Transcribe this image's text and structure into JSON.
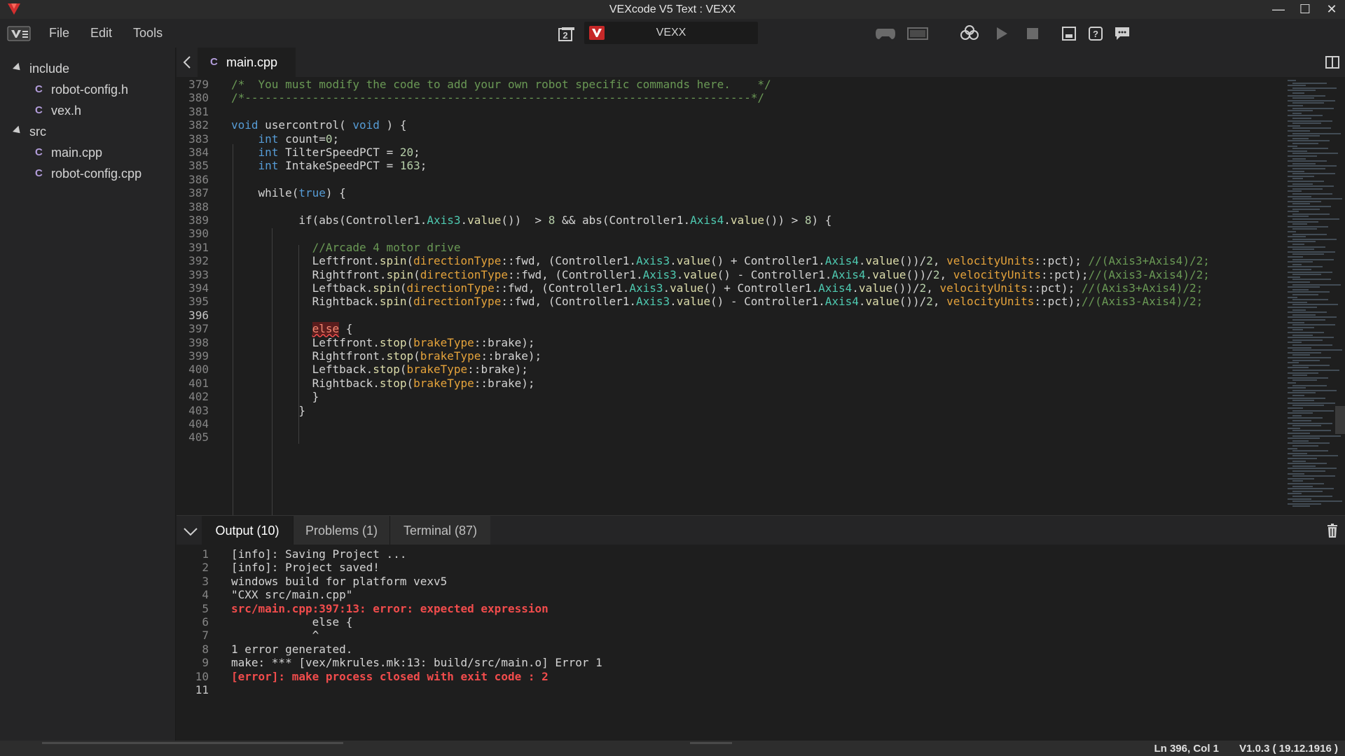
{
  "window": {
    "title": "VEXcode V5 Text : VEXX",
    "minimize": "—",
    "maximize": "☐",
    "close": "✕"
  },
  "menu": {
    "items": [
      "File",
      "Edit",
      "Tools"
    ]
  },
  "device": {
    "name": "VEXX",
    "slot": "2"
  },
  "toolbar": {
    "icons": [
      "controller-icon",
      "brain-screen-icon",
      "download-icon",
      "run-icon",
      "stop-icon",
      "device-info-icon",
      "help-icon",
      "feedback-icon"
    ]
  },
  "sidebar": {
    "tree": [
      {
        "label": "include",
        "type": "folder"
      },
      {
        "label": "robot-config.h",
        "type": "file"
      },
      {
        "label": "vex.h",
        "type": "file"
      },
      {
        "label": "src",
        "type": "folder"
      },
      {
        "label": "main.cpp",
        "type": "file"
      },
      {
        "label": "robot-config.cpp",
        "type": "file"
      }
    ]
  },
  "editor": {
    "tab_label": "main.cpp",
    "active_line": "396",
    "lines": [
      {
        "n": "379",
        "text": "/*  You must modify the code to add your own robot specific commands here.    */"
      },
      {
        "n": "380",
        "text": "/*---------------------------------------------------------------------------*/"
      },
      {
        "n": "381",
        "text": ""
      },
      {
        "n": "382",
        "text": "void usercontrol( void ) {"
      },
      {
        "n": "383",
        "text": "    int count=0;"
      },
      {
        "n": "384",
        "text": "    int TilterSpeedPCT = 20;"
      },
      {
        "n": "385",
        "text": "    int IntakeSpeedPCT = 163;"
      },
      {
        "n": "386",
        "text": ""
      },
      {
        "n": "387",
        "text": "    while(true) {"
      },
      {
        "n": "388",
        "text": ""
      },
      {
        "n": "389",
        "text": "          if(abs(Controller1.Axis3.value())  > 8 && abs(Controller1.Axis4.value()) > 8) {"
      },
      {
        "n": "390",
        "text": ""
      },
      {
        "n": "391",
        "text": "            //Arcade 4 motor drive"
      },
      {
        "n": "392",
        "text": "            Leftfront.spin(directionType::fwd, (Controller1.Axis3.value() + Controller1.Axis4.value())/2, velocityUnits::pct); //(Axis3+Axis4)/2;"
      },
      {
        "n": "393",
        "text": "            Rightfront.spin(directionType::fwd, (Controller1.Axis3.value() - Controller1.Axis4.value())/2, velocityUnits::pct);//(Axis3-Axis4)/2;"
      },
      {
        "n": "394",
        "text": "            Leftback.spin(directionType::fwd, (Controller1.Axis3.value() + Controller1.Axis4.value())/2, velocityUnits::pct); //(Axis3+Axis4)/2;"
      },
      {
        "n": "395",
        "text": "            Rightback.spin(directionType::fwd, (Controller1.Axis3.value() - Controller1.Axis4.value())/2, velocityUnits::pct);//(Axis3-Axis4)/2;"
      },
      {
        "n": "396",
        "text": ""
      },
      {
        "n": "397",
        "text": "            else {"
      },
      {
        "n": "398",
        "text": "            Leftfront.stop(brakeType::brake);"
      },
      {
        "n": "399",
        "text": "            Rightfront.stop(brakeType::brake);"
      },
      {
        "n": "400",
        "text": "            Leftback.stop(brakeType::brake);"
      },
      {
        "n": "401",
        "text": "            Rightback.stop(brakeType::brake);"
      },
      {
        "n": "402",
        "text": "            }"
      },
      {
        "n": "403",
        "text": "          }"
      },
      {
        "n": "404",
        "text": ""
      },
      {
        "n": "405",
        "text": ""
      }
    ]
  },
  "panel": {
    "tabs": [
      {
        "label": "Output (10)",
        "active": true
      },
      {
        "label": "Problems (1)",
        "active": false
      },
      {
        "label": "Terminal (87)",
        "active": false
      }
    ],
    "output": [
      {
        "n": "1",
        "text": "[info]: Saving Project ...",
        "error": false
      },
      {
        "n": "2",
        "text": "[info]: Project saved!",
        "error": false
      },
      {
        "n": "3",
        "text": "windows build for platform vexv5",
        "error": false
      },
      {
        "n": "4",
        "text": "\"CXX src/main.cpp\"",
        "error": false
      },
      {
        "n": "5",
        "text": "src/main.cpp:397:13: error: expected expression",
        "error": true
      },
      {
        "n": "6",
        "text": "            else {",
        "error": false
      },
      {
        "n": "7",
        "text": "            ^",
        "error": false
      },
      {
        "n": "8",
        "text": "1 error generated.",
        "error": false
      },
      {
        "n": "9",
        "text": "make: *** [vex/mkrules.mk:13: build/src/main.o] Error 1",
        "error": false
      },
      {
        "n": "10",
        "text": "[error]: make process closed with exit code : 2",
        "error": true
      },
      {
        "n": "11",
        "text": "",
        "error": false
      }
    ]
  },
  "status": {
    "position": "Ln 396, Col 1",
    "version": "V1.0.3 ( 19.12.1916 )"
  },
  "colors": {
    "accent_red": "#c8102e",
    "error_red": "#f14c4c",
    "keyword": "#569cd6",
    "comment": "#6a9955"
  }
}
